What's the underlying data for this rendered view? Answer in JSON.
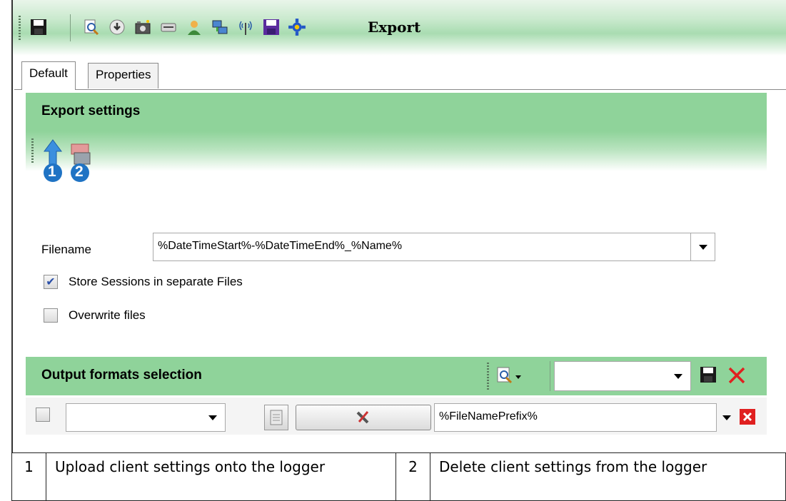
{
  "toolbar": {
    "icons": [
      "save-icon",
      "preview-icon",
      "download-icon",
      "camera-icon",
      "card-icon",
      "user-icon",
      "network-icon",
      "antenna-icon",
      "save-purple-icon",
      "export-gear-icon"
    ],
    "export_label": "Export"
  },
  "tabs": [
    {
      "label": "Default"
    },
    {
      "label": "Properties"
    }
  ],
  "export_settings": {
    "title": "Export settings",
    "upload_badge": "1",
    "delete_badge": "2",
    "filename_label": "Filename",
    "filename_value": "%DateTimeStart%-%DateTimeEnd%_%Name%",
    "store_sessions_label": "Store Sessions in separate Files",
    "store_sessions_checked": true,
    "overwrite_label": "Overwrite files",
    "overwrite_checked": false
  },
  "output_formats": {
    "title": "Output formats selection",
    "format_select_value": "",
    "row_prefix_value": "%FileNamePrefix%"
  },
  "legend": [
    {
      "num": "1",
      "text": "Upload client settings onto the logger"
    },
    {
      "num": "2",
      "text": "Delete client settings from the logger"
    }
  ],
  "colors": {
    "header_green": "#8fd39a",
    "badge_blue": "#1f73c4",
    "delete_red": "#e02020"
  }
}
